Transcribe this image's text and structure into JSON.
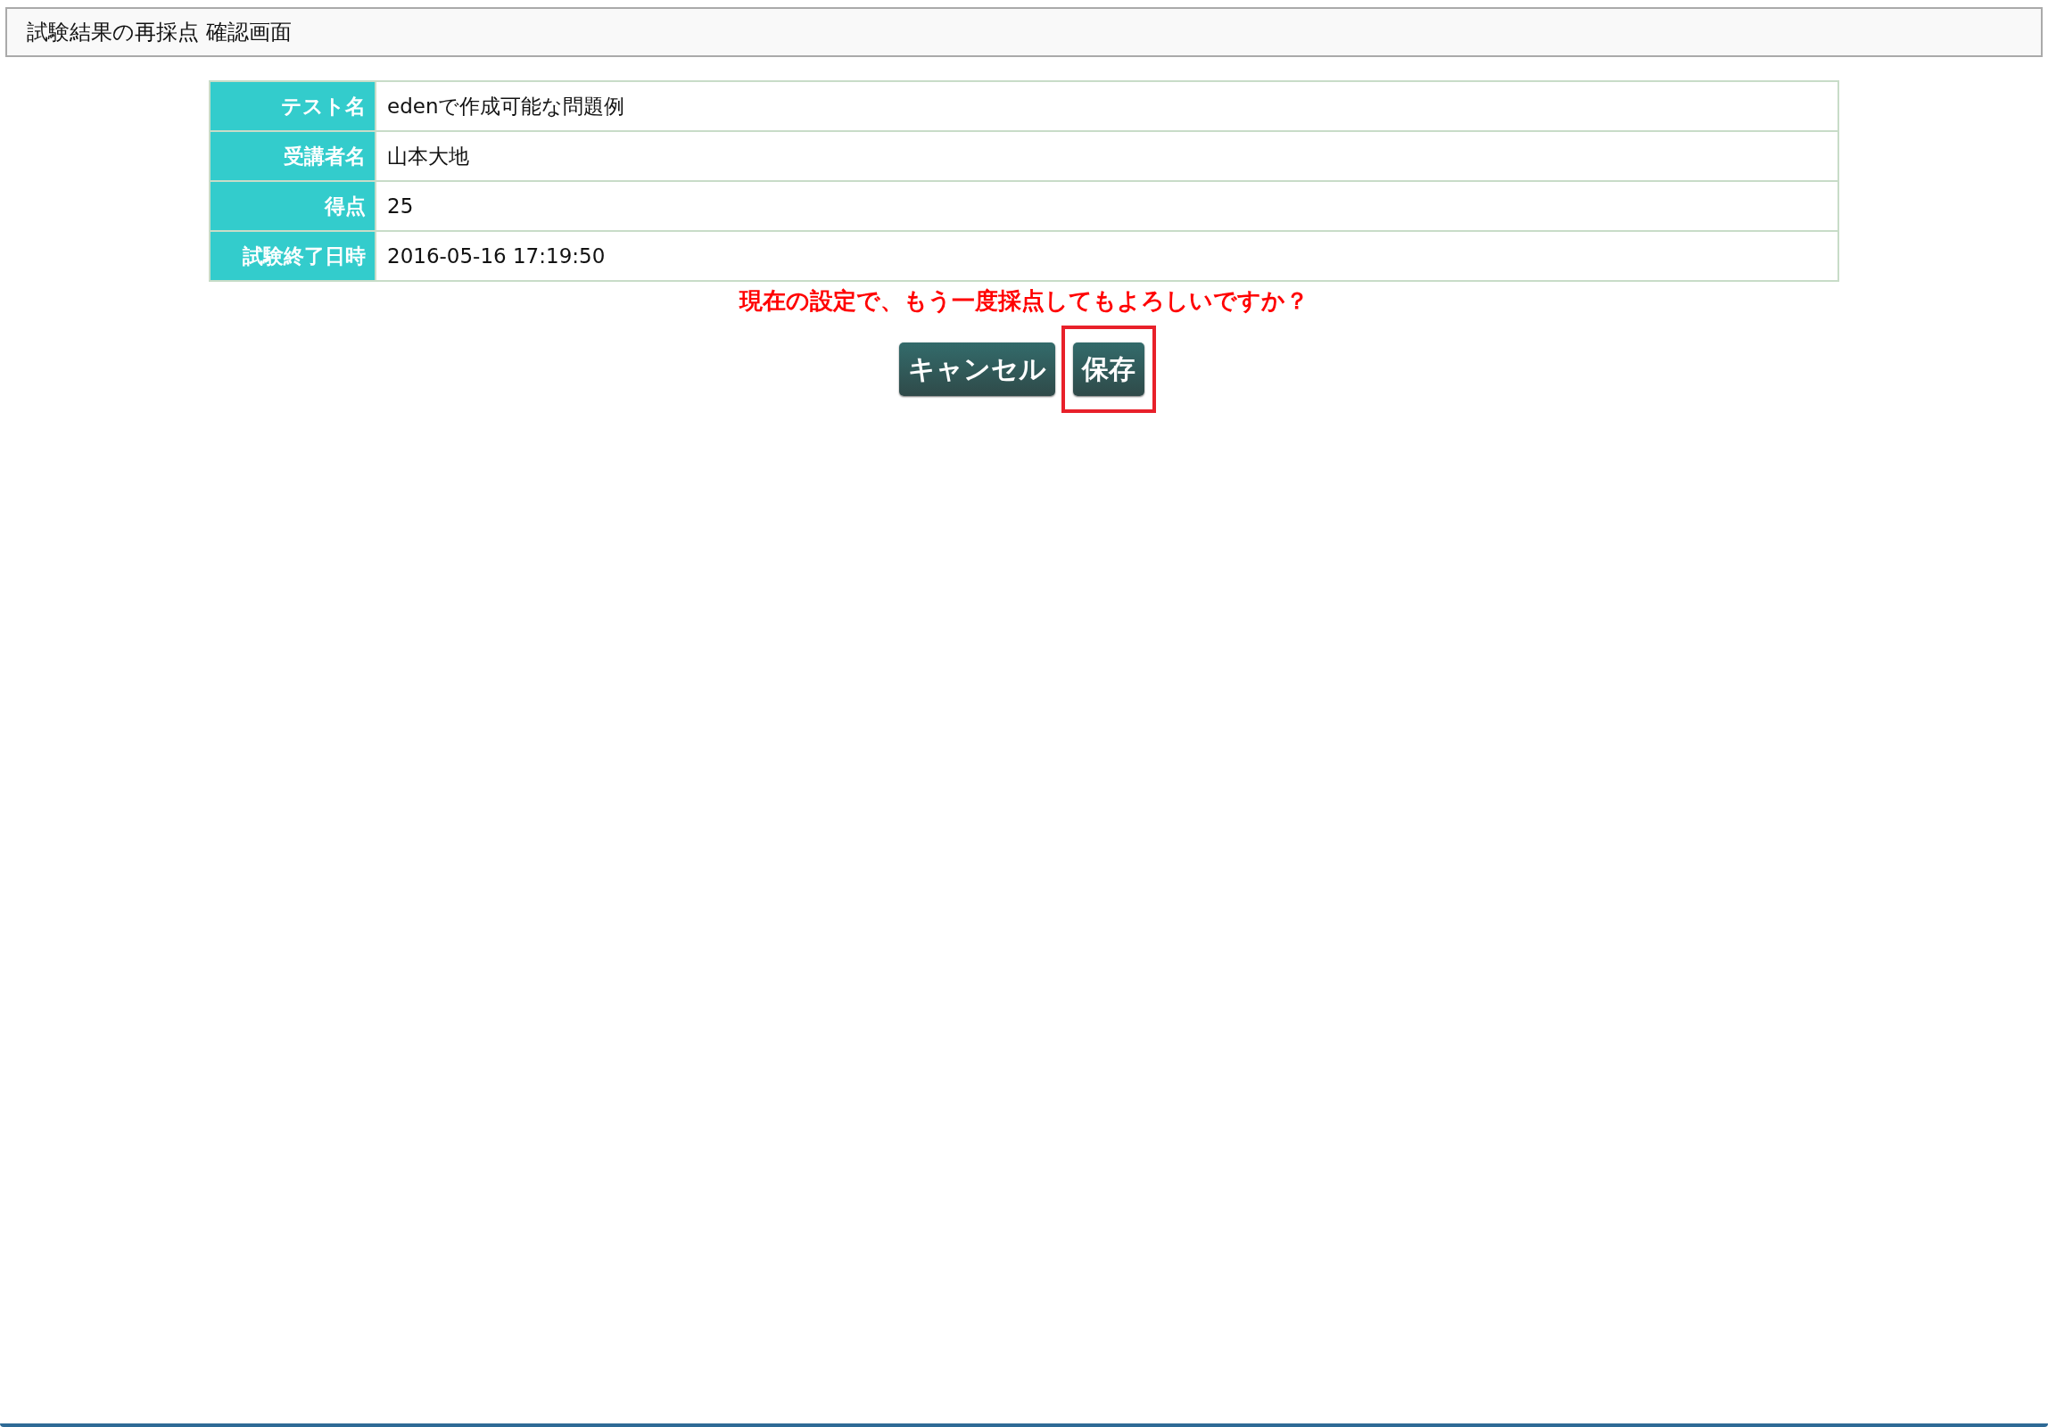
{
  "header": {
    "title": "試験結果の再採点 確認画面"
  },
  "details": [
    {
      "label": "テスト名",
      "value": "edenで作成可能な問題例"
    },
    {
      "label": "受講者名",
      "value": "山本大地"
    },
    {
      "label": "得点",
      "value": "25"
    },
    {
      "label": "試験終了日時",
      "value": "2016-05-16 17:19:50"
    }
  ],
  "message": "現在の設定で、もう一度採点してもよろしいですか？",
  "buttons": [
    {
      "label": "キャンセル",
      "highlighted": false
    },
    {
      "label": "保存",
      "highlighted": true
    }
  ]
}
